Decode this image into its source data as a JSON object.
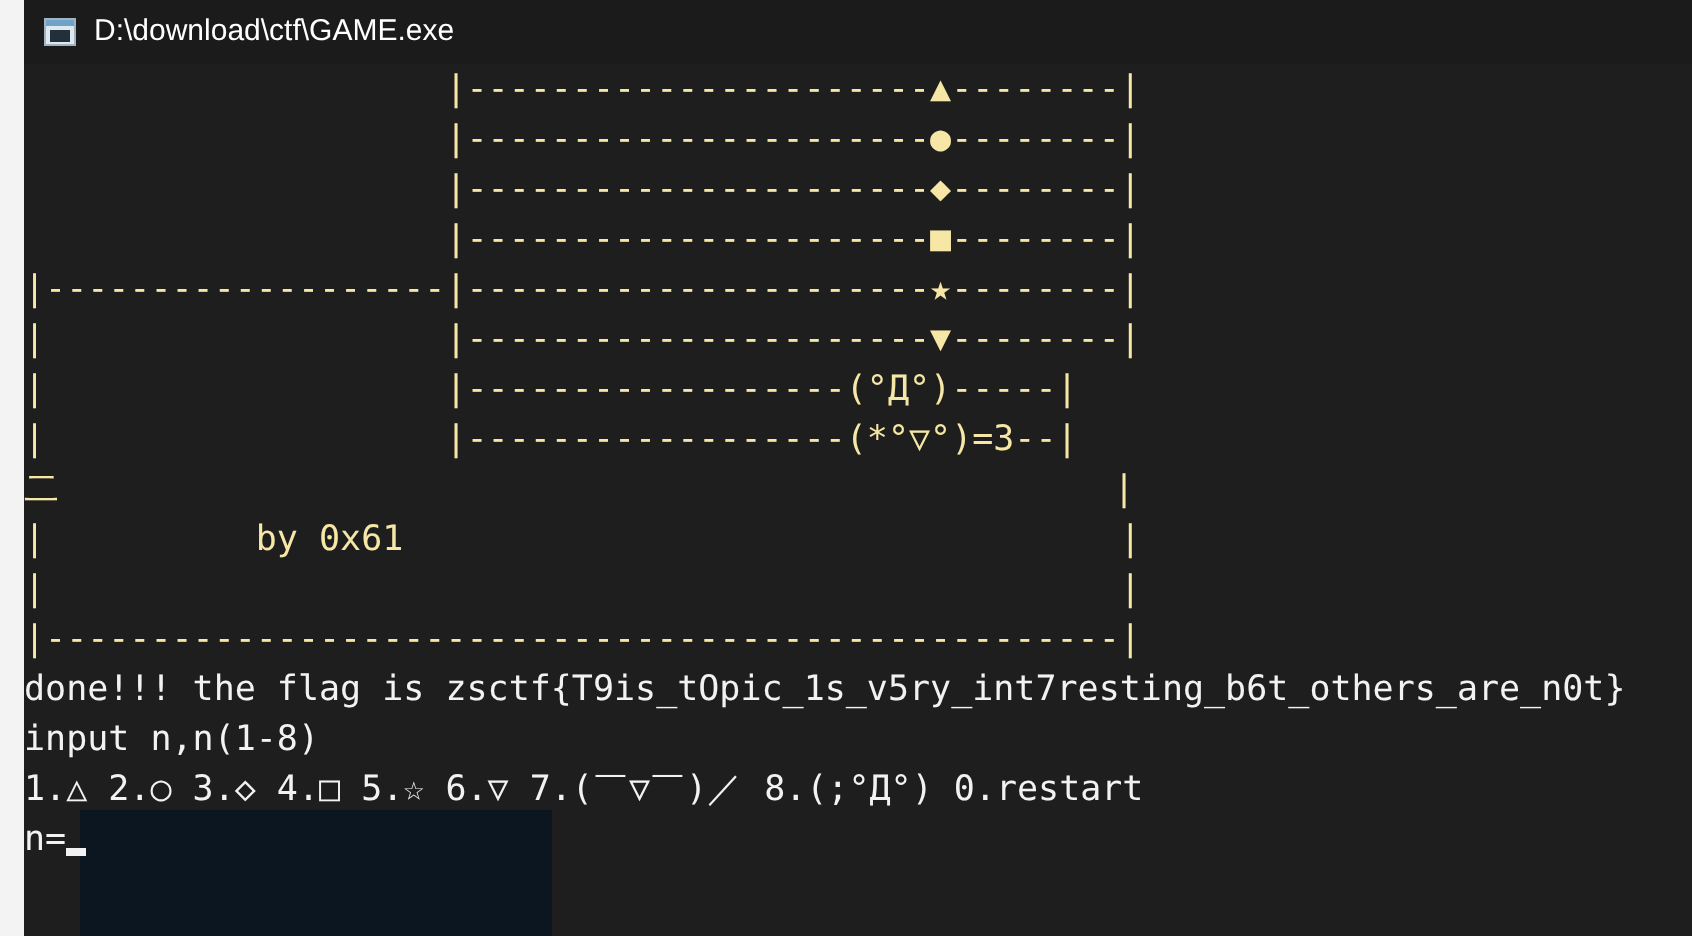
{
  "window": {
    "title": "D:\\download\\ctf\\GAME.exe"
  },
  "console": {
    "art_lines": [
      "                    |----------------------▲--------|",
      "                    |----------------------●--------|",
      "                    |----------------------◆--------|",
      "                    |----------------------■--------|",
      "|-------------------|----------------------★--------|",
      "|                   |----------------------▼--------|",
      "|                   |------------------(°Д°)-----|",
      "|                   |------------------(*°▽°)=3--|",
      "二                                                  |",
      "|          by 0x61                                  |",
      "|                                                   |",
      "|---------------------------------------------------|"
    ],
    "output_lines": [
      "done!!! the flag is zsctf{T9is_tOpic_1s_v5ry_int7resting_b6t_others_are_n0t}",
      "input n,n(1-8)",
      "1.△ 2.○ 3.◇ 4.□ 5.☆ 6.▽ 7.(￣▽￣)／ 8.(;°Д°) 0.restart"
    ],
    "prompt": "n="
  }
}
